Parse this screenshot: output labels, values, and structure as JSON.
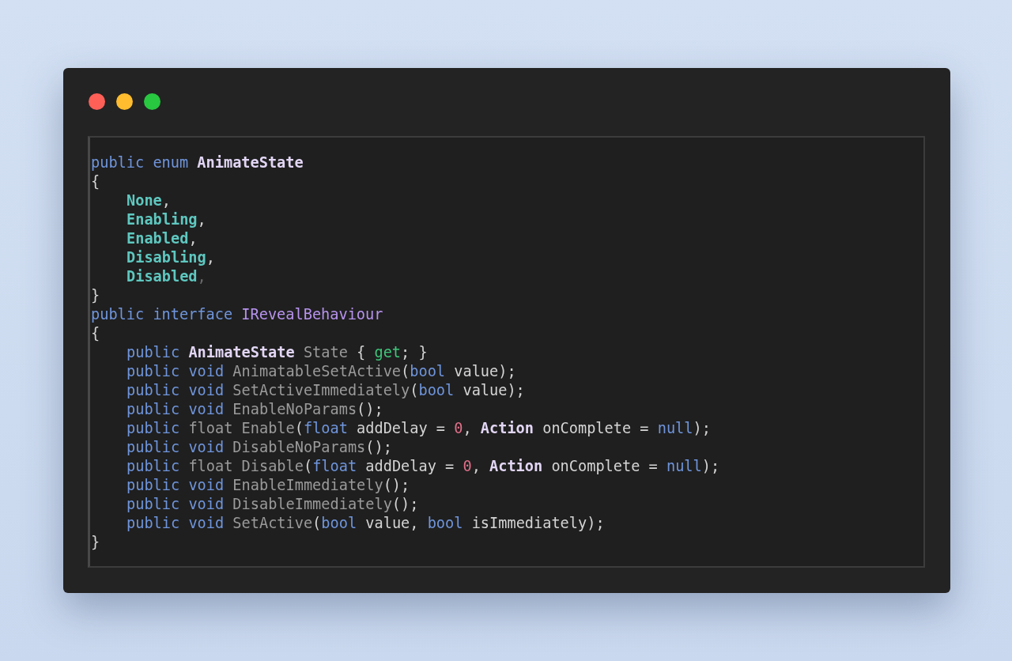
{
  "window": {
    "buttons": [
      {
        "kind": "close"
      },
      {
        "kind": "minimize"
      },
      {
        "kind": "zoom"
      }
    ]
  },
  "code": [
    {
      "tokens": [
        {
          "text": "public ",
          "kind": "keyword"
        },
        {
          "text": "enum ",
          "kind": "keyword"
        },
        {
          "text": "AnimateState",
          "kind": "type"
        }
      ]
    },
    {
      "tokens": [
        {
          "text": "{",
          "kind": "plain"
        }
      ],
      "children": [
        {
          "tokens": [
            {
              "text": "None",
              "kind": "member"
            },
            {
              "text": ",",
              "kind": "plain"
            }
          ]
        },
        {
          "tokens": [
            {
              "text": "Enabling",
              "kind": "member"
            },
            {
              "text": ",",
              "kind": "plain"
            }
          ]
        },
        {
          "tokens": [
            {
              "text": "Enabled",
              "kind": "member"
            },
            {
              "text": ",",
              "kind": "plain"
            }
          ]
        },
        {
          "tokens": [
            {
              "text": "Disabling",
              "kind": "member"
            },
            {
              "text": ",",
              "kind": "plain"
            }
          ]
        },
        {
          "tokens": [
            {
              "text": "Disabled",
              "kind": "member"
            },
            {
              "text": ",",
              "kind": "dim"
            }
          ]
        }
      ]
    },
    {
      "tokens": [
        {
          "text": "}",
          "kind": "plain"
        }
      ]
    },
    {
      "tokens": [
        {
          "text": "public ",
          "kind": "keyword"
        },
        {
          "text": "interface ",
          "kind": "keyword"
        },
        {
          "text": "IRevealBehaviour",
          "kind": "interface"
        }
      ]
    },
    {
      "tokens": [
        {
          "text": "{",
          "kind": "plain"
        }
      ],
      "children": [
        {
          "tokens": [
            {
              "text": "public ",
              "kind": "keyword"
            },
            {
              "text": "AnimateState ",
              "kind": "type"
            },
            {
              "text": "State ",
              "kind": "name"
            },
            {
              "text": "{ ",
              "kind": "plain"
            },
            {
              "text": "get",
              "kind": "accessor"
            },
            {
              "text": "; }",
              "kind": "plain"
            }
          ]
        },
        {
          "tokens": [
            {
              "text": "public ",
              "kind": "keyword"
            },
            {
              "text": "void ",
              "kind": "keyword"
            },
            {
              "text": "AnimatableSetActive",
              "kind": "name"
            },
            {
              "text": "(",
              "kind": "plain"
            },
            {
              "text": "bool ",
              "kind": "keyword"
            },
            {
              "text": "value);",
              "kind": "plain"
            }
          ]
        },
        {
          "tokens": [
            {
              "text": "public ",
              "kind": "keyword"
            },
            {
              "text": "void ",
              "kind": "keyword"
            },
            {
              "text": "SetActiveImmediately",
              "kind": "name"
            },
            {
              "text": "(",
              "kind": "plain"
            },
            {
              "text": "bool ",
              "kind": "keyword"
            },
            {
              "text": "value);",
              "kind": "plain"
            }
          ]
        },
        {
          "tokens": [
            {
              "text": "public ",
              "kind": "keyword"
            },
            {
              "text": "void ",
              "kind": "keyword"
            },
            {
              "text": "EnableNoParams",
              "kind": "name"
            },
            {
              "text": "();",
              "kind": "plain"
            }
          ]
        },
        {
          "tokens": [
            {
              "text": "public ",
              "kind": "keyword"
            },
            {
              "text": "float ",
              "kind": "name"
            },
            {
              "text": "Enable",
              "kind": "name"
            },
            {
              "text": "(",
              "kind": "plain"
            },
            {
              "text": "float ",
              "kind": "keyword"
            },
            {
              "text": "addDelay = ",
              "kind": "plain"
            },
            {
              "text": "0",
              "kind": "number"
            },
            {
              "text": ", ",
              "kind": "plain"
            },
            {
              "text": "Action ",
              "kind": "type"
            },
            {
              "text": "onComplete = ",
              "kind": "plain"
            },
            {
              "text": "null",
              "kind": "keyword"
            },
            {
              "text": ");",
              "kind": "plain"
            }
          ]
        },
        {
          "tokens": [
            {
              "text": "public ",
              "kind": "keyword"
            },
            {
              "text": "void ",
              "kind": "keyword"
            },
            {
              "text": "DisableNoParams",
              "kind": "name"
            },
            {
              "text": "();",
              "kind": "plain"
            }
          ]
        },
        {
          "tokens": [
            {
              "text": "public ",
              "kind": "keyword"
            },
            {
              "text": "float ",
              "kind": "name"
            },
            {
              "text": "Disable",
              "kind": "name"
            },
            {
              "text": "(",
              "kind": "plain"
            },
            {
              "text": "float ",
              "kind": "keyword"
            },
            {
              "text": "addDelay = ",
              "kind": "plain"
            },
            {
              "text": "0",
              "kind": "number"
            },
            {
              "text": ", ",
              "kind": "plain"
            },
            {
              "text": "Action ",
              "kind": "type"
            },
            {
              "text": "onComplete = ",
              "kind": "plain"
            },
            {
              "text": "null",
              "kind": "keyword"
            },
            {
              "text": ");",
              "kind": "plain"
            }
          ]
        },
        {
          "tokens": [
            {
              "text": "public ",
              "kind": "keyword"
            },
            {
              "text": "void ",
              "kind": "keyword"
            },
            {
              "text": "EnableImmediately",
              "kind": "name"
            },
            {
              "text": "();",
              "kind": "plain"
            }
          ]
        },
        {
          "tokens": [
            {
              "text": "public ",
              "kind": "keyword"
            },
            {
              "text": "void ",
              "kind": "keyword"
            },
            {
              "text": "DisableImmediately",
              "kind": "name"
            },
            {
              "text": "();",
              "kind": "plain"
            }
          ]
        },
        {
          "tokens": [
            {
              "text": "public ",
              "kind": "keyword"
            },
            {
              "text": "void ",
              "kind": "keyword"
            },
            {
              "text": "SetActive",
              "kind": "name"
            },
            {
              "text": "(",
              "kind": "plain"
            },
            {
              "text": "bool ",
              "kind": "keyword"
            },
            {
              "text": "value, ",
              "kind": "plain"
            },
            {
              "text": "bool ",
              "kind": "keyword"
            },
            {
              "text": "isImmediately);",
              "kind": "plain"
            }
          ]
        }
      ]
    },
    {
      "tokens": [
        {
          "text": "}",
          "kind": "plain"
        }
      ]
    }
  ]
}
